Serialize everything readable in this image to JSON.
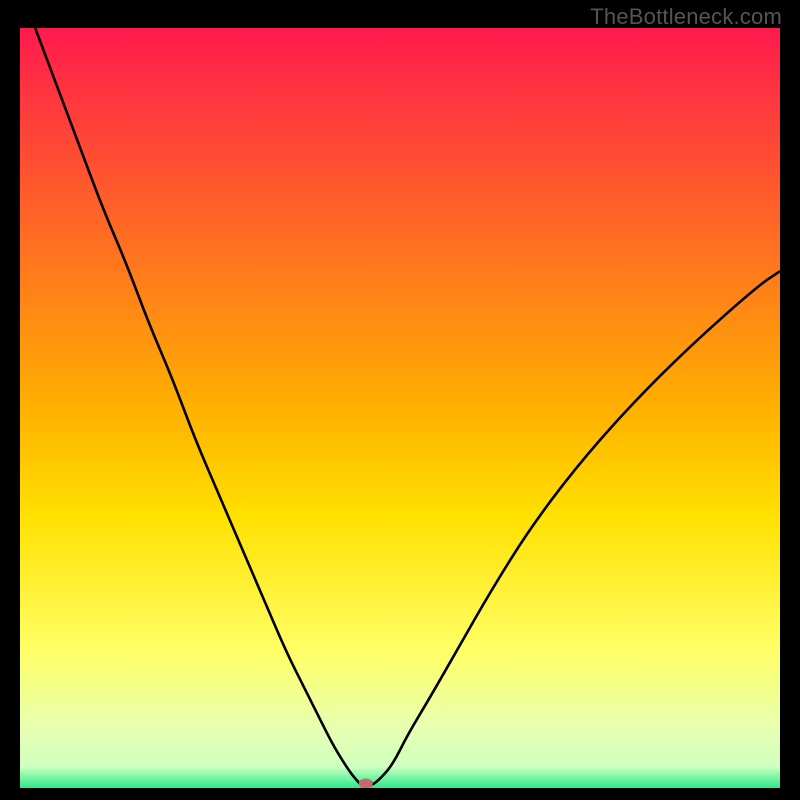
{
  "watermark": "TheBottleneck.com",
  "chart_data": {
    "type": "line",
    "title": "",
    "xlabel": "",
    "ylabel": "",
    "xlim": [
      0,
      100
    ],
    "ylim": [
      0,
      100
    ],
    "background_gradient": {
      "stops": [
        {
          "offset": 0.0,
          "color": "#ff1a4d"
        },
        {
          "offset": 0.5,
          "color": "#ffb000"
        },
        {
          "offset": 0.64,
          "color": "#ffe000"
        },
        {
          "offset": 0.82,
          "color": "#ffff66"
        },
        {
          "offset": 0.92,
          "color": "#e8ffb0"
        },
        {
          "offset": 0.972,
          "color": "#d0ffc0"
        },
        {
          "offset": 0.985,
          "color": "#7ef7a8"
        },
        {
          "offset": 1.0,
          "color": "#30e88a"
        }
      ]
    },
    "series": [
      {
        "name": "bottleneck-curve",
        "color": "#000000",
        "x": [
          2,
          5,
          8,
          11,
          14,
          17,
          20,
          23,
          26,
          29,
          32,
          35,
          37,
          39,
          41,
          42.5,
          43.5,
          44.3,
          45,
          46,
          47,
          49,
          51,
          54,
          58,
          62,
          67,
          73,
          80,
          88,
          97,
          100
        ],
        "y": [
          100,
          92,
          84,
          76,
          69,
          61,
          54,
          46,
          39,
          32,
          25,
          18,
          14,
          10,
          6,
          3.5,
          2,
          1,
          0.3,
          0.3,
          0.8,
          3,
          7,
          12,
          19,
          26,
          34,
          42,
          50,
          58,
          66,
          68
        ]
      }
    ],
    "marker": {
      "name": "min-point",
      "x": 45.5,
      "y": 0.6,
      "rx": 7,
      "ry": 5,
      "color": "#c56a6a"
    }
  }
}
